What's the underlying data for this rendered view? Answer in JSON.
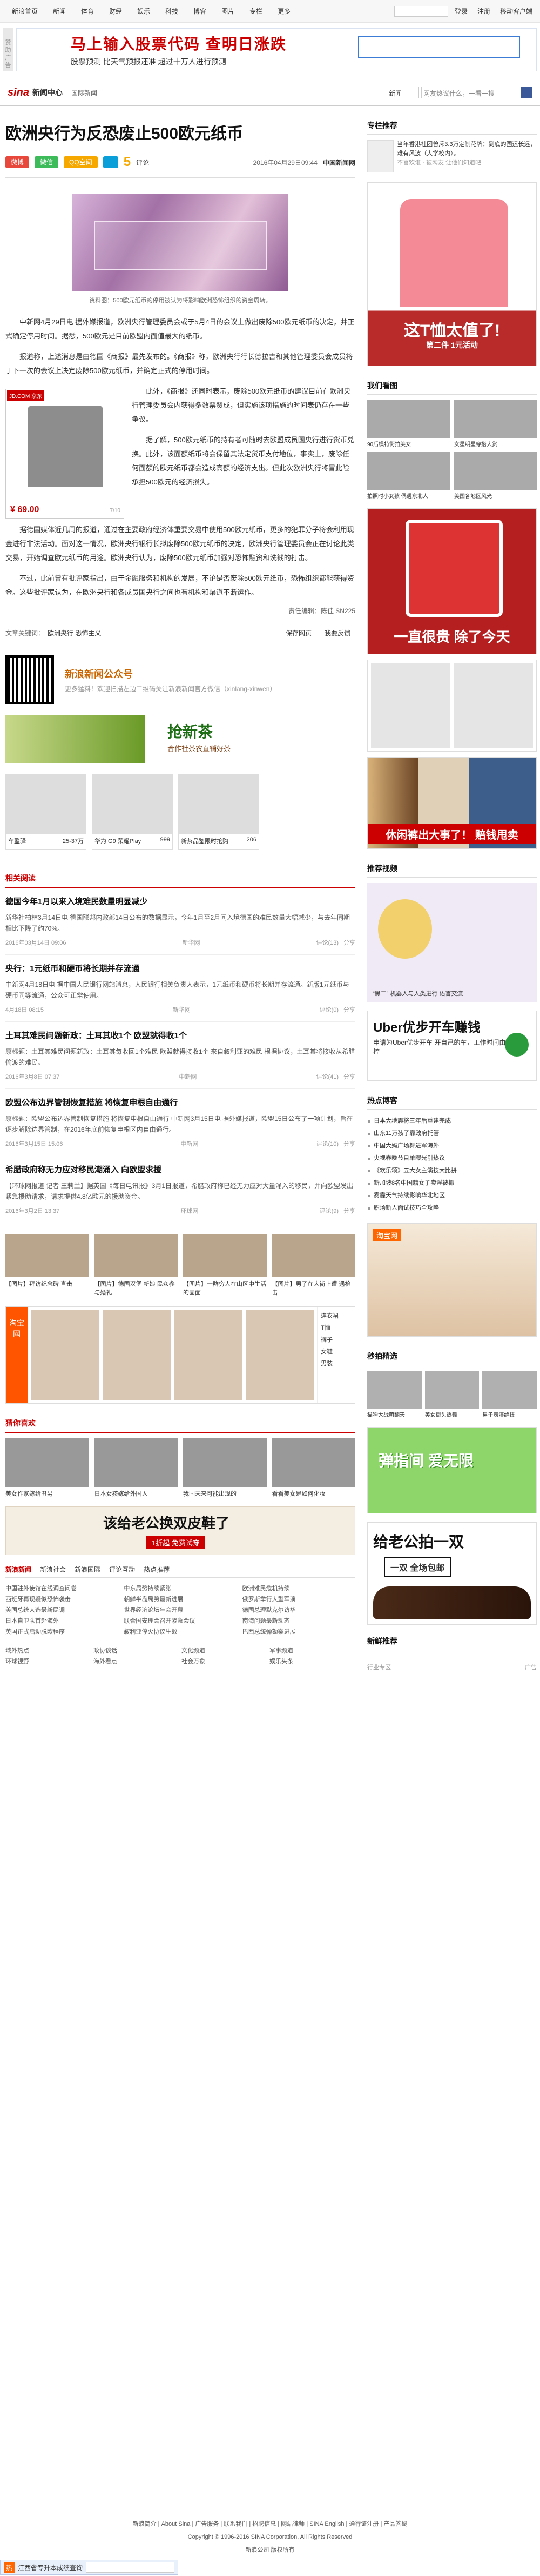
{
  "topbar": {
    "nav": [
      "新浪首页",
      "新闻",
      "体育",
      "财经",
      "娱乐",
      "科技",
      "博客",
      "图片",
      "专栏",
      "更多"
    ],
    "login": "登录",
    "register": "注册",
    "mobile": "移动客户端"
  },
  "banner": {
    "side_left": "赞助广告",
    "title": "马上输入股票代码 查明日涨跌",
    "sub": "股票预测 比天气预报还准 超过十万人进行预测"
  },
  "header": {
    "logo": "sina",
    "logo_text": "新闻中心",
    "crumb": "国际新闻",
    "search_select": "新闻",
    "search_placeholder": "网友热议什么，一看一搜"
  },
  "article": {
    "title": "欧洲央行为反恐废止500欧元纸币",
    "share_weibo": "微博",
    "share_weixin": "微信",
    "share_qq": "QQ空间",
    "comments": "5",
    "comments_label": "评论",
    "date": "2016年04月29日09:44",
    "source": "中国新闻网",
    "photo_caption": "资料图：500欧元纸币的停用被认为将影响欧洲恐怖组织的资金周转。",
    "p1": "中新网4月29日电 据外媒报道，欧洲央行管理委员会或于5月4日的会议上做出废除500欧元纸币的决定，并正式确定停用时间。据悉，500欧元是目前欧盟内面值最大的纸币。",
    "p2": "报道称，上述消息是由德国《商报》最先发布的。《商报》称，欧洲央行行长德拉吉和其他管理委员会成员将于下一次的会议上决定废除500欧元纸币，并确定正式的停用时间。",
    "p3": "此外，《商报》还同时表示，废除500欧元纸币的建议目前在欧洲央行管理委员会内获得多数票赞成，但实施该项措施的时间表仍存在一些争议。",
    "p4": "据了解，500欧元纸币的持有者可随时去欧盟成员国央行进行货币兑换。此外，该面额纸币将会保留其法定货币支付地位，事实上，废除任何面额的欧元纸币都会造成高额的经济支出。但此次欧洲央行将冒此险承担500欧元的经济损失。",
    "p5": "据德国媒体近几周的报道，通过在主要政府经济体重要交易中使用500欧元纸币，更多的犯罪分子将会利用现金进行非法活动。面对这一情况，欧洲央行银行长拟废除500欧元纸币的决定，欧洲央行管理委员会正在讨论此类交易，开始调查欧元纸币的用途。欧洲央行认为，废除500欧元纸币加强对恐怖融资和洗钱的打击。",
    "p6": "不过，此前曾有批评家指出，由于金融服务和机构的发展，不论是否废除500欧元纸币，恐怖组织都能获得资金。这些批评家认为，在欧洲央行和各成员国央行之间也有机构和渠道不断运作。",
    "ad_jd": "JD.COM 京东",
    "ad_price": "¥ 69.00",
    "ad_page": "7/10",
    "editor": "责任编辑：陈佳 SN225",
    "keywords_label": "文章关键词：",
    "keywords": "欧洲央行 恐怖主义",
    "tag_save": "保存网页",
    "tag_print": "我要反馈"
  },
  "pub": {
    "title": "新浪新闻公众号",
    "sub": "更多猛料！欢迎扫描左边二维码关注新浪新闻官方微信（xinlang-xinwen）"
  },
  "tea_ad": {
    "t1": "抢新茶",
    "t2": "合作社茶农直销好茶"
  },
  "products": [
    {
      "name": "车盈驿",
      "price": "25-37万"
    },
    {
      "name": "华为 G9 荣耀Play",
      "price": "999"
    },
    {
      "name": "新茶品鉴限时抢购",
      "price": "206"
    }
  ],
  "related": {
    "heading": "相关阅读",
    "items": [
      {
        "title": "德国今年1月以来入境难民数量明显减少",
        "body": "新华社柏林3月14日电 德国联邦内政部14日公布的数据显示，今年1月至2月间入境德国的难民数量大幅减少，与去年同期相比下降了约70%。",
        "date": "2016年03月14日 09:06",
        "src": "新华网",
        "cmt": "评论(13) | 分享"
      },
      {
        "title": "央行：1元纸币和硬币将长期并存流通",
        "body": "中新网4月18日电 据中国人民银行网站消息，人民银行相关负责人表示，1元纸币和硬币将长期并存流通。新版1元纸币与硬币同等流通，公众可正常使用。",
        "date": "4月18日 08:15",
        "src": "新华网",
        "cmt": "评论(0) | 分享"
      },
      {
        "title": "土耳其难民问题新政：土耳其收1个 欧盟就得收1个",
        "body": "原标题：土耳其难民问题新政：土耳其每收回1个难民 欧盟就得接收1个 来自叙利亚的难民 根据协议，土耳其将接收从希腊偷渡的难民。",
        "date": "2016年3月8日 07:37",
        "src": "中新网",
        "cmt": "评论(41) | 分享"
      },
      {
        "title": "欧盟公布边界管制恢复措施 将恢复申根自由通行",
        "body": "原标题：欧盟公布边界管制恢复措施 将恢复申根自由通行 中新网3月15日电 据外媒报道，欧盟15日公布了一项计划，旨在逐步解除边界管制，在2016年底前恢复申根区内自由通行。",
        "date": "2016年3月15日 15:06",
        "src": "中新网",
        "cmt": "评论(10) | 分享"
      },
      {
        "title": "希腊政府称无力应对移民潮涌入 向欧盟求援",
        "body": "【环球网报道 记者 王莉兰】据英国《每日电讯报》3月1日报道，希腊政府称已经无力应对大量涌入的移民，并向欧盟发出紧急援助请求，请求提供4.8亿欧元的援助资金。",
        "date": "2016年3月2日 13:37",
        "src": "环球网",
        "cmt": "评论(9) | 分享"
      }
    ]
  },
  "thumbs": [
    "【图片】拜访纪念碑 直击",
    "【图片】德国汉堡 新娘 民众参与婚礼",
    "【图片】一群穷人在山区中生活的画面",
    "【图片】男子在大街上遭 遇枪击"
  ],
  "taobao": {
    "label": "淘宝网",
    "side": [
      "连衣裙",
      "T恤",
      "裤子",
      "女鞋",
      "男装"
    ]
  },
  "recommend": {
    "heading": "猜你喜欢",
    "items": [
      "美女作家嫁给丑男",
      "日本女孩嫁给外国人",
      "我国未来可能出现的",
      "看看美女是如何化妆"
    ]
  },
  "shoe_ad": {
    "title": "该给老公换双皮鞋了",
    "sub": "1折起 免费试穿"
  },
  "tabs": [
    "新浪新闻",
    "新浪社会",
    "新浪国际",
    "评论互动",
    "热点推荐"
  ],
  "links": [
    [
      "中国驻外使馆在线调查问卷",
      "西班牙再现疑似恐怖袭击",
      "美国总统大选最新民调",
      "日本自卫队首赴海外",
      "英国正式启动脱欧程序"
    ],
    [
      "中东局势持续紧张",
      "朝鲜半岛局势最新进展",
      "世界经济论坛年会开幕",
      "联合国安理会召开紧急会议",
      "叙利亚停火协议生效"
    ],
    [
      "欧洲难民危机持续",
      "俄罗斯举行大型军演",
      "德国总理默克尔访华",
      "南海问题最新动态",
      "巴西总统弹劾案进展"
    ]
  ],
  "footer_grid": [
    "域外热点",
    "政协谈话",
    "文化频道",
    "军事频道",
    "环球视野",
    "海外看点",
    "社会万象",
    "娱乐头条"
  ],
  "footer": {
    "line1": "新浪简介 | About Sina | 广告服务 | 联系我们 | 招聘信息 | 网站律师 | SINA English | 通行证注册 | 产品答疑",
    "line2": "Copyright © 1996-2016 SINA Corporation, All Rights Reserved",
    "line3": "新浪公司 版权所有"
  },
  "float_bar": {
    "tag": "热",
    "text": "江西省专升本成绩查询"
  },
  "right": {
    "rec_heading": "专栏推荐",
    "rec_text": "当年香港社团曾斥3.3万定制花牌：到底的国运长远，难有风波（大学校内）。",
    "rec_sub": "不喜欢谁 · 被网友 让他们知道吧",
    "ad1_big": "这T恤太值了!",
    "ad1_sm": "第二件 1元活动",
    "look_heading": "我们看图",
    "look": [
      "90后模特街拍美女",
      "女星明星穿搭大赏",
      "拍照时小女孩 偶遇东北人",
      "美国各地区风光"
    ],
    "ad2": "一直很贵 除了今天",
    "ad3": "休闲裤出大事了！ 赔钱甩卖",
    "video_heading": "推荐视频",
    "video_caption": "“黑二” 机器人与人类进行 语言交流",
    "uber_t": "Uber优步开车赚钱",
    "uber_s": "申请为Uber优步开车 开自己的车，工作时间由自己掌控",
    "hot_heading": "热点博客",
    "hot": [
      "日本大地震将三年后重建完成",
      "山东11万孩子靠政府托管",
      "中国大妈广场舞进军海外",
      "央视春晚节目单曝光引热议",
      "《欢乐颂》五大女主演技大比拼",
      "新加坡8名中国籍女子卖淫被抓",
      "雾霾天气持续影响华北地区",
      "职场新人面试技巧全攻略"
    ],
    "tb2": "淘宝网",
    "grab_heading": "秒拍精选",
    "grab": [
      "猫狗大战萌翻天",
      "美女街头热舞",
      "男子表演绝技"
    ],
    "spring": "弹指间 爱无限",
    "dad_t": "给老公拍一双",
    "dad_b": "一双 全场包邮",
    "rfoot": "新鲜推荐",
    "pre_l": "行业专区",
    "pre_r": "广告"
  }
}
